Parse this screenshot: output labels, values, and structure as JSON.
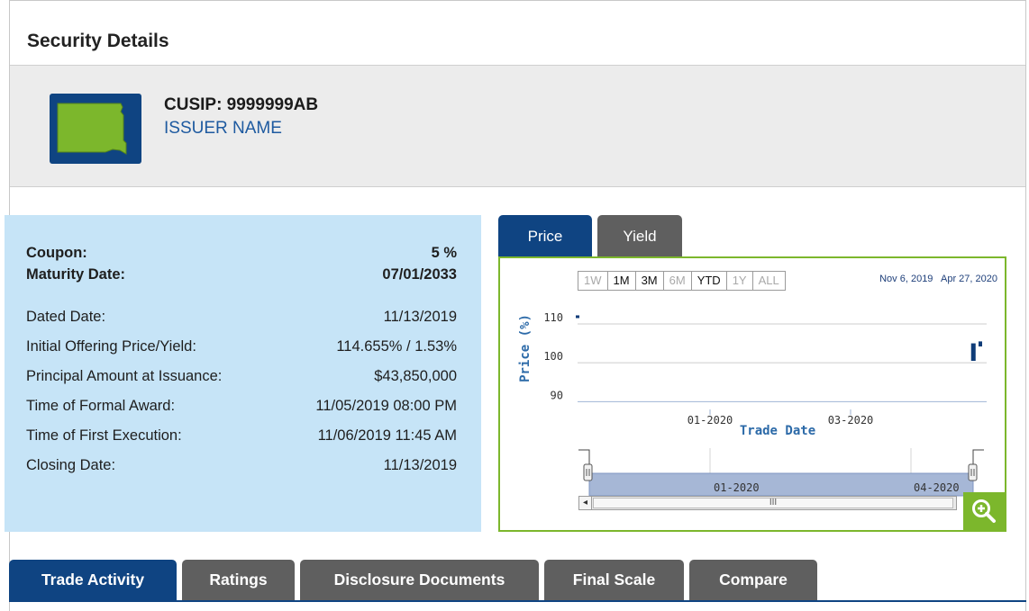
{
  "header": {
    "title": "Security Details"
  },
  "issuer": {
    "cusip_label": "CUSIP: 9999999AB",
    "name": "ISSUER NAME",
    "state_icon": "south-dakota-state-icon",
    "state_color": "#7cb72c",
    "icon_bg": "#0f4482"
  },
  "details": {
    "primary": [
      {
        "label": "Coupon:",
        "value": "5 %"
      },
      {
        "label": "Maturity Date:",
        "value": "07/01/2033"
      }
    ],
    "secondary": [
      {
        "label": "Dated Date:",
        "value": "11/13/2019"
      },
      {
        "label": "Initial Offering Price/Yield:",
        "value": "114.655% / 1.53%"
      },
      {
        "label": "Principal Amount at Issuance:",
        "value": "$43,850,000"
      },
      {
        "label": "Time of Formal Award:",
        "value": "11/05/2019 08:00 PM"
      },
      {
        "label": "Time of First Execution:",
        "value": "11/06/2019 11:45 AM"
      },
      {
        "label": "Closing Date:",
        "value": "11/13/2019"
      }
    ]
  },
  "chart_tabs": [
    {
      "label": "Price",
      "active": true
    },
    {
      "label": "Yield",
      "active": false
    }
  ],
  "range_selector": {
    "buttons": [
      {
        "label": "1W",
        "enabled": false
      },
      {
        "label": "1M",
        "enabled": true
      },
      {
        "label": "3M",
        "enabled": true
      },
      {
        "label": "6M",
        "enabled": false
      },
      {
        "label": "YTD",
        "enabled": true
      },
      {
        "label": "1Y",
        "enabled": false
      },
      {
        "label": "ALL",
        "enabled": false
      }
    ],
    "from_date": "Nov 6, 2019",
    "to_date": "Apr 27, 2020"
  },
  "chart_data": {
    "type": "bar",
    "xlabel": "Trade Date",
    "ylabel": "Price (%)",
    "yticks": [
      90,
      100,
      110
    ],
    "ylim": [
      88,
      113
    ],
    "xticks": [
      "01-2020",
      "03-2020"
    ],
    "navigator_ticks": [
      "01-2020",
      "04-2020"
    ],
    "grid": true,
    "series_color": "#0f3c78",
    "x": [
      "2019-11-06",
      "2020-04-24",
      "2020-04-27"
    ],
    "series": [
      {
        "name": "",
        "low": [
          111.5,
          100.5,
          104.2
        ],
        "high": [
          112.2,
          105.0,
          105.5
        ]
      }
    ]
  },
  "navigator": {
    "thumb_grip": "III",
    "left_arrow": "◂"
  },
  "zoom": {
    "icon": "zoom-in-icon"
  },
  "bottom_tabs": [
    {
      "label": "Trade Activity",
      "active": true
    },
    {
      "label": "Ratings",
      "active": false
    },
    {
      "label": "Disclosure Documents",
      "active": false
    },
    {
      "label": "Final Scale",
      "active": false
    },
    {
      "label": "Compare",
      "active": false
    }
  ]
}
